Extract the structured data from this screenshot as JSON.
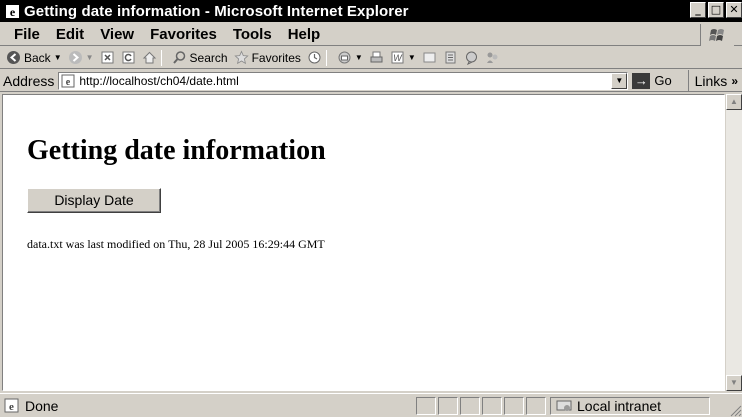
{
  "window": {
    "title": "Getting date information - Microsoft Internet Explorer",
    "minimize": "_",
    "maximize": "□",
    "close": "✕"
  },
  "menu": {
    "items": [
      "File",
      "Edit",
      "View",
      "Favorites",
      "Tools",
      "Help"
    ]
  },
  "toolbar": {
    "back_label": "Back",
    "search_label": "Search",
    "favorites_label": "Favorites"
  },
  "address": {
    "label": "Address",
    "url": "http://localhost/ch04/date.html",
    "go_label": "Go",
    "links_label": "Links"
  },
  "page": {
    "heading": "Getting date information",
    "button_label": "Display Date",
    "result": "data.txt was last modified on Thu, 28 Jul 2005 16:29:44 GMT"
  },
  "status": {
    "text": "Done",
    "zone": "Local intranet"
  },
  "colors": {
    "titlebar": "#000000",
    "chrome": "#d4d0c8",
    "content_bg": "#ffffff"
  }
}
